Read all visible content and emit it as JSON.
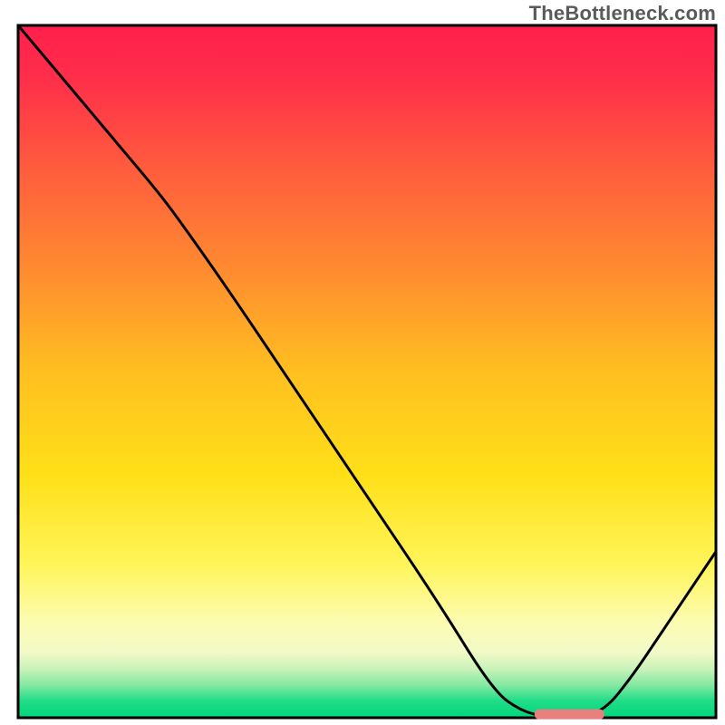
{
  "attribution": "TheBottleneck.com",
  "chart_data": {
    "type": "line",
    "title": "",
    "xlabel": "",
    "ylabel": "",
    "xlim": [
      0,
      100
    ],
    "ylim": [
      0,
      100
    ],
    "series": [
      {
        "name": "curve",
        "x": [
          0,
          5,
          10,
          15,
          20,
          23,
          30,
          40,
          50,
          60,
          68,
          72,
          76,
          80,
          84,
          88,
          92,
          96,
          100
        ],
        "y": [
          100,
          94,
          88,
          82,
          76,
          72,
          62,
          47,
          32,
          17,
          4,
          1,
          0,
          0,
          1,
          6,
          12,
          18,
          24
        ]
      }
    ],
    "marker": {
      "name": "optimum-marker",
      "x_start": 74,
      "x_end": 84,
      "y": 0.5,
      "color": "#e8807f"
    },
    "gradient_stops": [
      {
        "offset": 0.0,
        "color": "#ff1f4b"
      },
      {
        "offset": 0.08,
        "color": "#ff2f4a"
      },
      {
        "offset": 0.2,
        "color": "#ff5a3e"
      },
      {
        "offset": 0.35,
        "color": "#ff8a30"
      },
      {
        "offset": 0.5,
        "color": "#ffbf20"
      },
      {
        "offset": 0.65,
        "color": "#ffe018"
      },
      {
        "offset": 0.78,
        "color": "#fff55a"
      },
      {
        "offset": 0.86,
        "color": "#fcfcb0"
      },
      {
        "offset": 0.905,
        "color": "#f2fac8"
      },
      {
        "offset": 0.93,
        "color": "#c8f2b8"
      },
      {
        "offset": 0.955,
        "color": "#7be8a0"
      },
      {
        "offset": 0.975,
        "color": "#22dd88"
      },
      {
        "offset": 1.0,
        "color": "#00d67a"
      }
    ],
    "frame_color": "#000000",
    "frame_width": 3,
    "curve_color": "#000000",
    "curve_width": 3
  }
}
